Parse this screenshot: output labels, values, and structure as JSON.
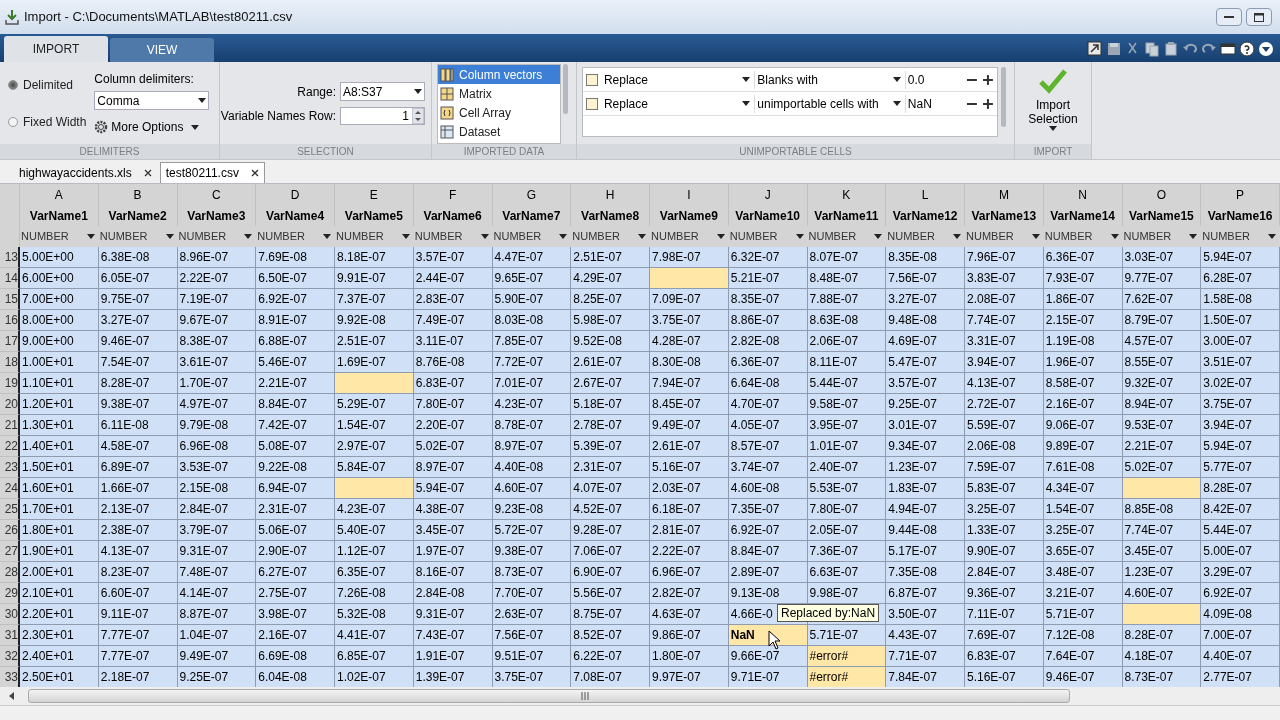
{
  "window": {
    "title": "Import - C:\\Documents\\MATLAB\\test80211.csv"
  },
  "ribbon_tabs": [
    {
      "label": "IMPORT",
      "selected": true
    },
    {
      "label": "VIEW",
      "selected": false
    }
  ],
  "delimiters": {
    "section": "DELIMITERS",
    "options": [
      {
        "label": "Delimited",
        "selected": true
      },
      {
        "label": "Fixed Width",
        "selected": false
      }
    ],
    "column_delimiters_label": "Column delimiters:",
    "column_delimiters": "Comma",
    "more_options": "More Options"
  },
  "selection": {
    "section": "SELECTION",
    "range_label": "Range:",
    "range": "A8:S37",
    "names_row_label": "Variable Names Row:",
    "names_row": "1"
  },
  "imported_data": {
    "section": "IMPORTED DATA",
    "options": [
      {
        "label": "Column vectors",
        "selected": true
      },
      {
        "label": "Matrix",
        "selected": false
      },
      {
        "label": "Cell Array",
        "selected": false
      },
      {
        "label": "Dataset",
        "selected": false
      }
    ]
  },
  "unimportable_cells": {
    "section": "UNIMPORTABLE CELLS",
    "rules": [
      {
        "checked": false,
        "action": "Replace",
        "condition": "Blanks with",
        "value": "0.0"
      },
      {
        "checked": false,
        "action": "Replace",
        "condition": "unimportable cells with",
        "value": "NaN"
      }
    ]
  },
  "import": {
    "section": "IMPORT",
    "button": "Import Selection"
  },
  "documents": [
    {
      "label": "highwayaccidents.xls",
      "selected": false
    },
    {
      "label": "test80211.csv",
      "selected": true
    }
  ],
  "table": {
    "columns": [
      {
        "letter": "A",
        "name": "VarName1",
        "type": "NUMBER"
      },
      {
        "letter": "B",
        "name": "VarName2",
        "type": "NUMBER"
      },
      {
        "letter": "C",
        "name": "VarName3",
        "type": "NUMBER"
      },
      {
        "letter": "D",
        "name": "VarName4",
        "type": "NUMBER"
      },
      {
        "letter": "E",
        "name": "VarName5",
        "type": "NUMBER"
      },
      {
        "letter": "F",
        "name": "VarName6",
        "type": "NUMBER"
      },
      {
        "letter": "G",
        "name": "VarName7",
        "type": "NUMBER"
      },
      {
        "letter": "H",
        "name": "VarName8",
        "type": "NUMBER"
      },
      {
        "letter": "I",
        "name": "VarName9",
        "type": "NUMBER"
      },
      {
        "letter": "J",
        "name": "VarName10",
        "type": "NUMBER"
      },
      {
        "letter": "K",
        "name": "VarName11",
        "type": "NUMBER"
      },
      {
        "letter": "L",
        "name": "VarName12",
        "type": "NUMBER"
      },
      {
        "letter": "M",
        "name": "VarName13",
        "type": "NUMBER"
      },
      {
        "letter": "N",
        "name": "VarName14",
        "type": "NUMBER"
      },
      {
        "letter": "O",
        "name": "VarName15",
        "type": "NUMBER"
      },
      {
        "letter": "P",
        "name": "VarName16",
        "type": "NUMBER"
      }
    ],
    "rows": [
      {
        "row": "13",
        "cells": [
          "5.00E+00",
          "6.38E-08",
          "8.96E-07",
          "7.69E-08",
          "8.18E-07",
          "3.57E-07",
          "4.47E-07",
          "2.51E-07",
          "7.98E-07",
          "6.32E-07",
          "8.07E-07",
          "8.35E-08",
          "7.96E-07",
          "6.36E-07",
          "3.03E-07",
          "5.94E-07"
        ]
      },
      {
        "row": "14",
        "cells": [
          "6.00E+00",
          "6.05E-07",
          "2.22E-07",
          "6.50E-07",
          "9.91E-07",
          "2.44E-07",
          "9.65E-07",
          "4.29E-07",
          {
            "highlighted": true
          },
          "5.21E-07",
          "8.48E-07",
          "7.56E-07",
          "3.83E-07",
          "7.93E-07",
          "9.77E-07",
          "6.28E-07"
        ]
      },
      {
        "row": "15",
        "cells": [
          "7.00E+00",
          "9.75E-07",
          "7.19E-07",
          "6.92E-07",
          "7.37E-07",
          "2.83E-07",
          "5.90E-07",
          "8.25E-07",
          "7.09E-07",
          "8.35E-07",
          "7.88E-07",
          "3.27E-07",
          "2.08E-07",
          "1.86E-07",
          "7.62E-07",
          "1.58E-08"
        ]
      },
      {
        "row": "16",
        "cells": [
          "8.00E+00",
          "3.27E-07",
          "9.67E-07",
          "8.91E-07",
          "9.92E-08",
          "7.49E-07",
          "8.03E-08",
          "5.98E-07",
          "3.75E-07",
          "8.86E-07",
          "8.63E-08",
          "9.48E-08",
          "7.74E-07",
          "2.15E-07",
          "8.79E-07",
          "1.50E-07"
        ]
      },
      {
        "row": "17",
        "cells": [
          "9.00E+00",
          "9.46E-07",
          "8.38E-07",
          "6.88E-07",
          "2.51E-07",
          "3.11E-07",
          "7.85E-07",
          "9.52E-08",
          "4.28E-07",
          "2.82E-08",
          "2.06E-07",
          "4.69E-07",
          "3.31E-07",
          "1.19E-08",
          "4.57E-07",
          "3.00E-07"
        ]
      },
      {
        "row": "18",
        "cells": [
          "1.00E+01",
          "7.54E-07",
          "3.61E-07",
          "5.46E-07",
          "1.69E-07",
          "8.76E-08",
          "7.72E-07",
          "2.61E-07",
          "8.30E-08",
          "6.36E-07",
          "8.11E-07",
          "5.47E-07",
          "3.94E-07",
          "1.96E-07",
          "8.55E-07",
          "3.51E-07"
        ]
      },
      {
        "row": "19",
        "cells": [
          "1.10E+01",
          "8.28E-07",
          "1.70E-07",
          "2.21E-07",
          {
            "highlighted": true
          },
          "6.83E-07",
          "7.01E-07",
          "2.67E-07",
          "7.94E-07",
          "6.64E-08",
          "5.44E-07",
          "3.57E-07",
          "4.13E-07",
          "8.58E-07",
          "9.32E-07",
          "3.02E-07"
        ]
      },
      {
        "row": "20",
        "cells": [
          "1.20E+01",
          "9.38E-07",
          "4.97E-07",
          "8.84E-07",
          "5.29E-07",
          "7.80E-07",
          "4.23E-07",
          "5.18E-07",
          "8.45E-07",
          "4.70E-07",
          "9.58E-07",
          "9.25E-07",
          "2.72E-07",
          "2.16E-07",
          "8.94E-07",
          "3.75E-07"
        ]
      },
      {
        "row": "21",
        "cells": [
          "1.30E+01",
          "6.11E-08",
          "9.79E-08",
          "7.42E-07",
          "1.54E-07",
          "2.20E-07",
          "8.78E-07",
          "2.78E-07",
          "9.49E-07",
          "4.05E-07",
          "3.95E-07",
          "3.01E-07",
          "5.59E-07",
          "9.06E-07",
          "9.53E-07",
          "3.94E-07"
        ]
      },
      {
        "row": "22",
        "cells": [
          "1.40E+01",
          "4.58E-07",
          "6.96E-08",
          "5.08E-07",
          "2.97E-07",
          "5.02E-07",
          "8.97E-07",
          "5.39E-07",
          "2.61E-07",
          "8.57E-07",
          "1.01E-07",
          "9.34E-07",
          "2.06E-08",
          "9.89E-07",
          "2.21E-07",
          "5.94E-07"
        ]
      },
      {
        "row": "23",
        "cells": [
          "1.50E+01",
          "6.89E-07",
          "3.53E-07",
          "9.22E-08",
          "5.84E-07",
          "8.97E-07",
          "4.40E-08",
          "2.31E-07",
          "5.16E-07",
          "3.74E-07",
          "2.40E-07",
          "1.23E-07",
          "7.59E-07",
          "7.61E-08",
          "5.02E-07",
          "5.77E-07"
        ]
      },
      {
        "row": "24",
        "cells": [
          "1.60E+01",
          "1.66E-07",
          "2.15E-08",
          "6.94E-07",
          {
            "highlighted": true
          },
          "5.94E-07",
          "4.60E-07",
          "4.07E-07",
          "2.03E-07",
          "4.60E-08",
          "5.53E-07",
          "1.83E-07",
          "5.83E-07",
          "4.34E-07",
          {
            "highlighted": true
          },
          "8.28E-07"
        ]
      },
      {
        "row": "25",
        "cells": [
          "1.70E+01",
          "2.13E-07",
          "2.84E-07",
          "2.31E-07",
          "4.23E-07",
          "4.38E-07",
          "9.23E-08",
          "4.52E-07",
          "6.18E-07",
          "7.35E-07",
          "7.80E-07",
          "4.94E-07",
          "3.25E-07",
          "1.54E-07",
          "8.85E-08",
          "8.42E-07"
        ]
      },
      {
        "row": "26",
        "cells": [
          "1.80E+01",
          "2.38E-07",
          "3.79E-07",
          "5.06E-07",
          "5.40E-07",
          "3.45E-07",
          "5.72E-07",
          "9.28E-07",
          "2.81E-07",
          "6.92E-07",
          "2.05E-07",
          "9.44E-08",
          "1.33E-07",
          "3.25E-07",
          "7.74E-07",
          "5.44E-07"
        ]
      },
      {
        "row": "27",
        "cells": [
          "1.90E+01",
          "4.13E-07",
          "9.31E-07",
          "2.90E-07",
          "1.12E-07",
          "1.97E-07",
          "9.38E-07",
          "7.06E-07",
          "2.22E-07",
          "8.84E-07",
          "7.36E-07",
          "5.17E-07",
          "9.90E-07",
          "3.65E-07",
          "3.45E-07",
          "5.00E-07"
        ]
      },
      {
        "row": "28",
        "cells": [
          "2.00E+01",
          "8.23E-07",
          "7.48E-07",
          "6.27E-07",
          "6.35E-07",
          "8.16E-07",
          "8.73E-07",
          "6.90E-07",
          "6.96E-07",
          "2.89E-07",
          "6.63E-07",
          "7.35E-08",
          "2.84E-07",
          "3.48E-07",
          "1.23E-07",
          "3.29E-07"
        ]
      },
      {
        "row": "29",
        "cells": [
          "2.10E+01",
          "6.60E-07",
          "4.14E-07",
          "2.75E-07",
          "7.26E-08",
          "2.84E-08",
          "7.70E-07",
          "5.56E-07",
          "2.82E-07",
          "9.13E-08",
          "9.98E-07",
          "6.87E-07",
          "9.36E-07",
          "3.21E-07",
          "4.60E-07",
          "6.92E-07"
        ]
      },
      {
        "row": "30",
        "cells": [
          "2.20E+01",
          "9.11E-07",
          "8.87E-07",
          "3.98E-07",
          "5.32E-08",
          "9.31E-07",
          "2.63E-07",
          "8.75E-07",
          "4.63E-07",
          "4.66E-0",
          null,
          "3.50E-07",
          "7.11E-07",
          "5.71E-07",
          {
            "highlighted": true
          },
          "4.09E-08"
        ]
      },
      {
        "row": "31",
        "cells": [
          "2.30E+01",
          "7.77E-07",
          "1.04E-07",
          "2.16E-07",
          "4.41E-07",
          "7.43E-07",
          "7.56E-07",
          "8.52E-07",
          "9.86E-07",
          {
            "text": "NaN",
            "highlighted": true,
            "bold": true
          },
          "5.71E-07",
          "4.43E-07",
          "7.69E-07",
          "7.12E-08",
          "8.28E-07",
          "7.00E-07"
        ]
      },
      {
        "row": "32",
        "cells": [
          "2.40E+01",
          "7.77E-07",
          "9.49E-07",
          "6.69E-08",
          "6.85E-07",
          "1.91E-07",
          "9.51E-07",
          "6.22E-07",
          "1.80E-07",
          "9.66E-07",
          {
            "text": "#error#",
            "highlighted": true,
            "bold": false
          },
          "7.71E-07",
          "6.83E-07",
          "7.64E-07",
          "4.18E-07",
          "4.40E-07"
        ]
      },
      {
        "row": "33",
        "cells": [
          "2.50E+01",
          "2.18E-07",
          "9.25E-07",
          "6.04E-08",
          "1.02E-07",
          "1.39E-07",
          "3.75E-07",
          "7.08E-07",
          "9.97E-07",
          "9.71E-07",
          {
            "text": "#error#",
            "highlighted": true,
            "bold": false
          },
          "7.84E-07",
          "5.16E-07",
          "9.46E-07",
          "8.73E-07",
          "2.77E-07"
        ]
      }
    ]
  },
  "tooltip": "Replaced by:NaN"
}
